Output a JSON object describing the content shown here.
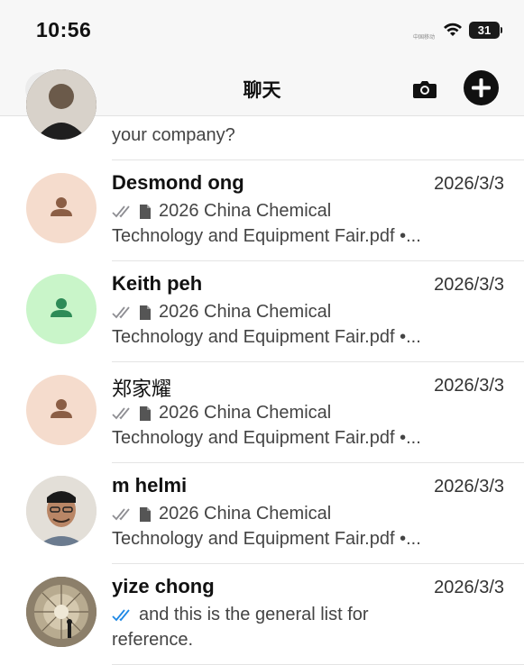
{
  "status": {
    "time": "10:56",
    "battery": "31",
    "carrier": "中国移动"
  },
  "header": {
    "title": "聊天"
  },
  "first_row": {
    "preview_tail": "your company?"
  },
  "chats": [
    {
      "name": "Desmond ong",
      "date": "2026/3/3",
      "preview1": "2026 China Chemical",
      "preview2": "Technology and Equipment Fair.pdf •...",
      "tick": "gray",
      "avatar": "placeholder-peach"
    },
    {
      "name": "Keith peh",
      "date": "2026/3/3",
      "preview1": "2026 China Chemical",
      "preview2": "Technology and Equipment Fair.pdf •...",
      "tick": "gray",
      "avatar": "placeholder-green"
    },
    {
      "name": "郑家耀",
      "date": "2026/3/3",
      "preview1": "2026 China Chemical",
      "preview2": "Technology and Equipment Fair.pdf •...",
      "tick": "gray",
      "avatar": "placeholder-peach"
    },
    {
      "name": "m helmi",
      "date": "2026/3/3",
      "preview1": "2026 China Chemical",
      "preview2": "Technology and Equipment Fair.pdf •...",
      "tick": "gray",
      "avatar": "photo-man"
    },
    {
      "name": "yize chong",
      "date": "2026/3/3",
      "preview1": "and this is the general list for",
      "preview2": "reference.",
      "tick": "blue",
      "avatar": "photo-dome"
    }
  ],
  "colors": {
    "tick_gray": "#8e8e93",
    "tick_blue": "#1e88e5",
    "peach_bg": "#f5dccd",
    "peach_fg": "#8b5e45",
    "green_bg": "#c9f5c9",
    "green_fg": "#2e8b57"
  }
}
